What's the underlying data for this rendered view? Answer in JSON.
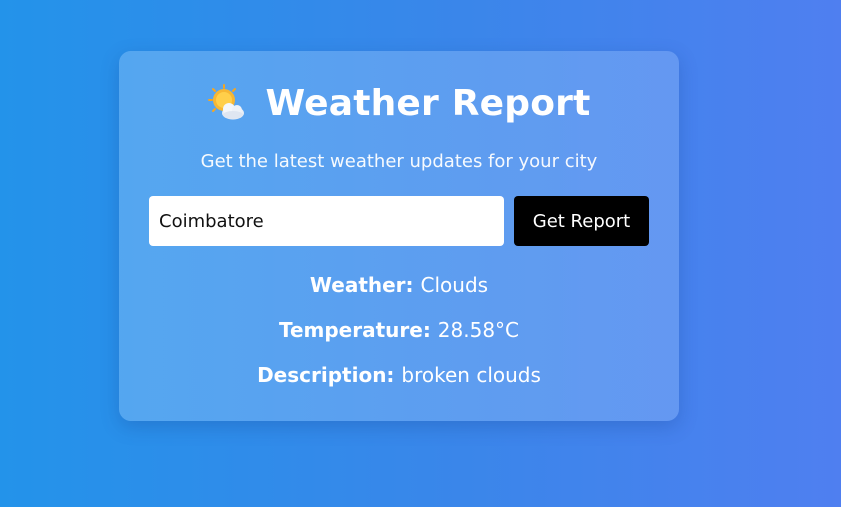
{
  "app": {
    "title": "Weather Report",
    "subtitle": "Get the latest weather updates for your city"
  },
  "search": {
    "value": "Coimbatore",
    "button_label": "Get Report"
  },
  "results": {
    "weather_label": "Weather:",
    "weather_value": "Clouds",
    "temperature_label": "Temperature:",
    "temperature_value": "28.58°C",
    "description_label": "Description:",
    "description_value": "broken clouds"
  },
  "icons": {
    "title_icon": "sun-behind-cloud-icon"
  },
  "colors": {
    "button_bg": "#000000",
    "text": "#ffffff"
  }
}
